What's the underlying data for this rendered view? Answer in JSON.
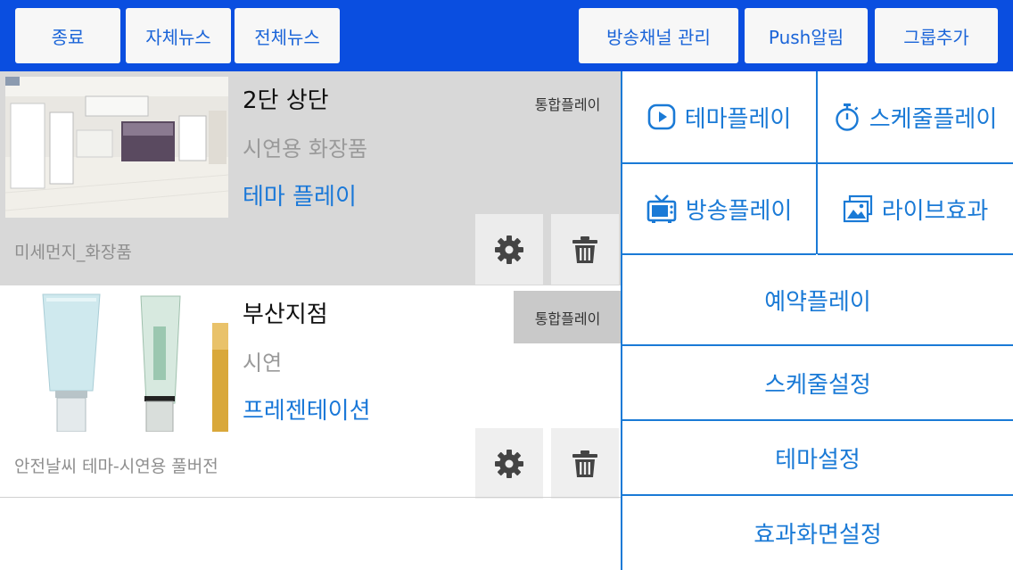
{
  "toolbar": {
    "exit_label": "종료",
    "own_news_label": "자체뉴스",
    "all_news_label": "전체뉴스",
    "channel_manage_label": "방송채널 관리",
    "push_label": "Push알림",
    "add_group_label": "그룹추가"
  },
  "channels": [
    {
      "title": "2단 상단",
      "subtitle": "시연용 화장품",
      "mode": "테마 플레이",
      "badge": "통합플레이",
      "description": "미세먼지_화장품"
    },
    {
      "title": "부산지점",
      "subtitle": "시연",
      "mode": "프레젠테이션",
      "badge": "통합플레이",
      "description": "안전날씨 테마-시연용 풀버전"
    }
  ],
  "menu": {
    "theme_play": "테마플레이",
    "schedule_play": "스케줄플레이",
    "broadcast_play": "방송플레이",
    "live_effect": "라이브효과",
    "reserve_play": "예약플레이",
    "schedule_settings": "스케줄설정",
    "theme_settings": "테마설정",
    "effect_screen_settings": "효과화면설정"
  },
  "icons": {
    "theme_play": "play-circle-icon",
    "schedule_play": "stopwatch-icon",
    "broadcast_play": "tv-icon",
    "live_effect": "photos-icon",
    "settings": "gear-icon",
    "delete": "trash-icon"
  },
  "colors": {
    "toolbar_bg": "#0a4ee0",
    "accent": "#1a7ad6",
    "selected_card_bg": "#d8d8d8"
  }
}
